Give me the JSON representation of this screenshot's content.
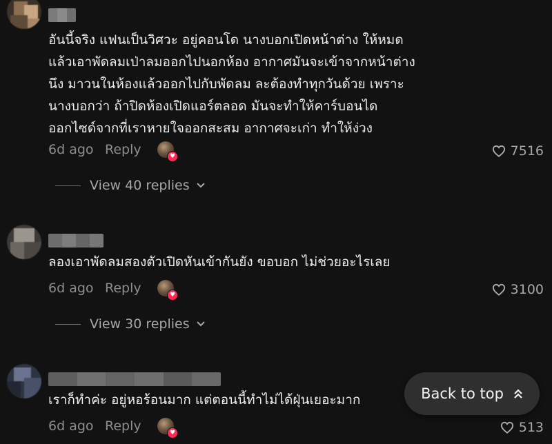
{
  "comments": [
    {
      "text": "อันนี้จริง แฟนเป็นวิศวะ อยู่คอนโด นางบอกเปิดหน้าต่าง ให้หมด\nแล้วเอาพัดลมเป่าลมออกไปนอกห้อง อากาศมันจะเข้าจากหน้าต่าง\nนึง มาวนในห้องแล้วออกไปกับพัดลม ละต้องทำทุกวันด้วย เพราะ\nนางบอกว่า ถ้าปิดห้องเปิดแอร์ตลอด มันจะทำให้คาร์บอนได\nออกไซด์จากที่เราหายใจออกสะสม อากาศจะเก่า ทำให้ง่วง",
      "time": "6d ago",
      "reply_label": "Reply",
      "likes": "7516",
      "view_replies": "View 40 replies"
    },
    {
      "text": "ลองเอาพัดลมสองตัวเปิดหันเข้ากันยัง ขอบอก ไม่ช่วยอะไรเลย",
      "time": "6d ago",
      "reply_label": "Reply",
      "likes": "3100",
      "view_replies": "View 30 replies"
    },
    {
      "text": "เราก็ทำค่ะ อยู่หอร้อนมาก แต่ตอนนี้ทำไม่ได้ฝุ่นเยอะมาก",
      "time": "6d ago",
      "reply_label": "Reply",
      "likes": "513"
    }
  ],
  "back_to_top": "Back to top",
  "icons": {
    "like": "heart-outline-icon",
    "expand": "chevron-down-icon",
    "back_to_top": "double-chevron-up-icon",
    "creator_liked": "heart-badge-icon"
  },
  "colors": {
    "background": "#121212",
    "text": "#ececec",
    "muted": "#8e8e8e",
    "creator_like_badge": "#fe2c55",
    "button_bg": "#2f2f2f"
  }
}
